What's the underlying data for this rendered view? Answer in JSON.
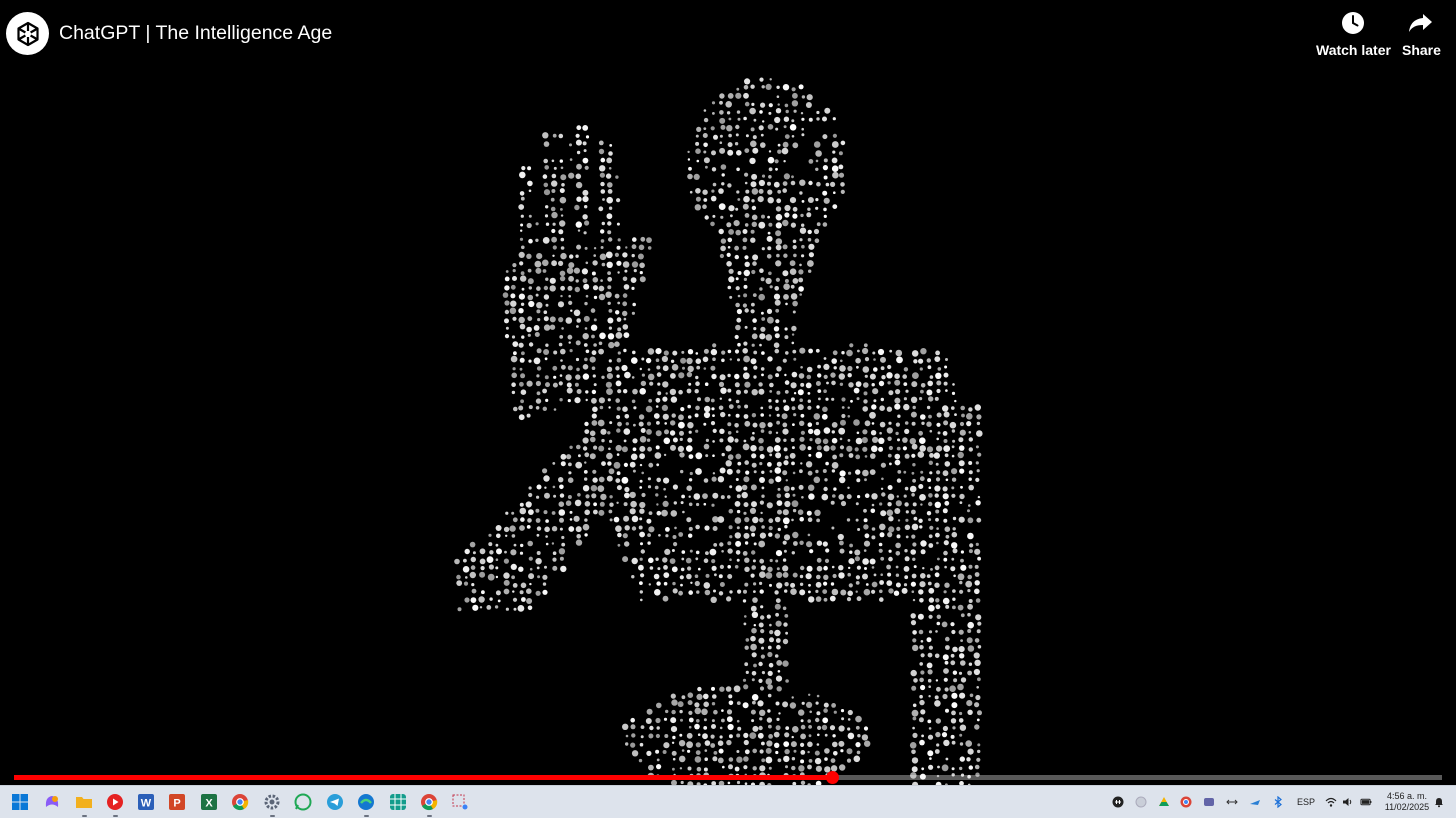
{
  "video": {
    "title": "ChatGPT | The Intelligence Age",
    "progress_fraction": 0.573,
    "accent_color": "#ff0000",
    "actions": {
      "watch_later": {
        "label": "Watch later",
        "icon": "clock-icon"
      },
      "share": {
        "label": "Share",
        "icon": "share-arrow-icon"
      }
    },
    "channel_avatar_icon": "openai-logo-icon"
  },
  "taskbar": {
    "apps": [
      {
        "name": "start",
        "icon": "windows-icon",
        "color": "#0a78d7"
      },
      {
        "name": "copilot",
        "icon": "copilot-icon",
        "color": "#8a5cf6"
      },
      {
        "name": "file-explorer",
        "icon": "folder-icon",
        "color": "#f2b01e"
      },
      {
        "name": "youtube-music",
        "icon": "play-circle-icon",
        "color": "#e52222"
      },
      {
        "name": "word",
        "icon": "word-icon",
        "color": "#2b5fb8"
      },
      {
        "name": "powerpoint",
        "icon": "powerpoint-icon",
        "color": "#d24726"
      },
      {
        "name": "excel",
        "icon": "excel-icon",
        "color": "#1d7344"
      },
      {
        "name": "chrome",
        "icon": "chrome-icon",
        "color": "#2b9a4b"
      },
      {
        "name": "settings",
        "icon": "gear-icon",
        "color": "#5b6577"
      },
      {
        "name": "whatsapp",
        "icon": "whatsapp-icon",
        "color": "#1fa855"
      },
      {
        "name": "telegram",
        "icon": "telegram-icon",
        "color": "#2a9ed9"
      },
      {
        "name": "edge",
        "icon": "edge-icon",
        "color": "#1478d0"
      },
      {
        "name": "calculator-grid",
        "icon": "grid-app-icon",
        "color": "#139c8c"
      },
      {
        "name": "chrome-profile",
        "icon": "chrome-icon",
        "color": "#d44a3a"
      },
      {
        "name": "snipping-tool",
        "icon": "snip-icon",
        "color": "#c4344a"
      }
    ],
    "tray": {
      "language": "ESP",
      "time": "4:56 a. m.",
      "date": "11/02/2025"
    }
  }
}
